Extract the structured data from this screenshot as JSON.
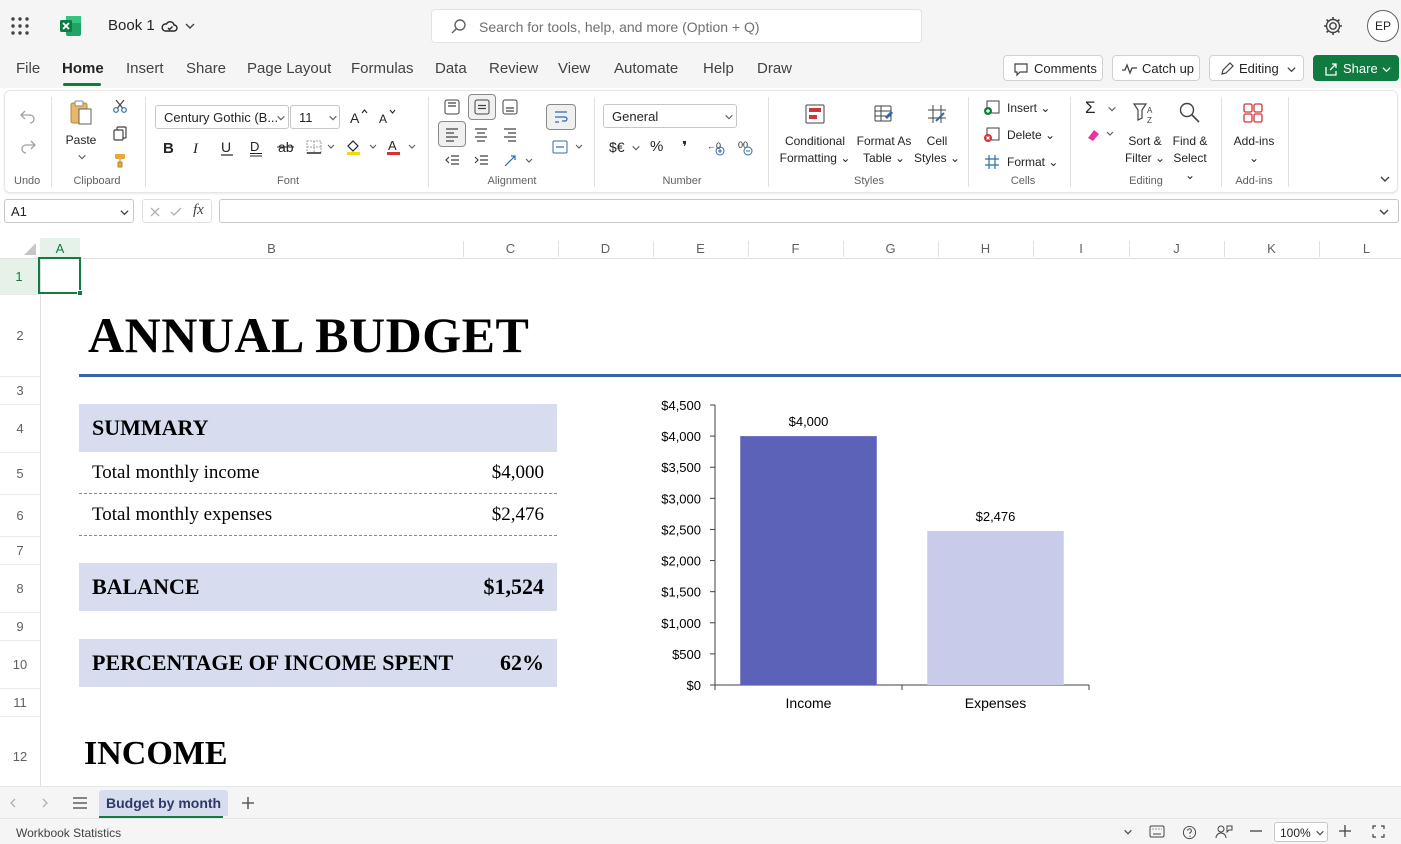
{
  "titlebar": {
    "book_name": "Book 1",
    "search_placeholder": "Search for tools, help, and more (Option + Q)",
    "avatar_initials": "EP"
  },
  "menu": {
    "items": [
      "File",
      "Home",
      "Insert",
      "Share",
      "Page Layout",
      "Formulas",
      "Data",
      "Review",
      "View",
      "Automate",
      "Help",
      "Draw"
    ],
    "active": "Home",
    "comments_label": "Comments",
    "catchup_label": "Catch up",
    "editing_label": "Editing",
    "share_label": "Share"
  },
  "ribbon": {
    "undo_group": "Undo",
    "clipboard": {
      "paste_label": "Paste",
      "group": "Clipboard"
    },
    "font": {
      "family": "Century Gothic (B...",
      "size": "11",
      "group": "Font"
    },
    "alignment": {
      "group": "Alignment"
    },
    "number": {
      "format": "General",
      "currency_glyph": "$€",
      "percent_glyph": "%",
      "comma_glyph": "❜",
      "group": "Number"
    },
    "styles": {
      "conditional_line1": "Conditional",
      "conditional_line2": "Formatting",
      "format_table_line1": "Format As",
      "format_table_line2": "Table",
      "cell_styles_line1": "Cell",
      "cell_styles_line2": "Styles",
      "group": "Styles"
    },
    "cells": {
      "insert": "Insert",
      "delete": "Delete",
      "format": "Format",
      "group": "Cells"
    },
    "editing": {
      "sort_line1": "Sort &",
      "sort_line2": "Filter",
      "find_line1": "Find &",
      "find_line2": "Select",
      "autosum_glyph": "Σ",
      "group": "Editing"
    },
    "addins": {
      "label": "Add-ins",
      "group": "Add-ins"
    }
  },
  "formula_bar": {
    "name_box": "A1",
    "fx_glyph": "fx",
    "formula": ""
  },
  "grid": {
    "columns": [
      "A",
      "B",
      "C",
      "D",
      "E",
      "F",
      "G",
      "H",
      "I",
      "J",
      "K",
      "L"
    ],
    "rows": [
      "1",
      "2",
      "3",
      "4",
      "5",
      "6",
      "7",
      "8",
      "9",
      "10",
      "11",
      "12"
    ],
    "selected_col": "A",
    "selected_row": "1"
  },
  "sheet": {
    "title": "ANNUAL BUDGET",
    "summary_header": "SUMMARY",
    "income_label": "Total monthly income",
    "income_value": "$4,000",
    "expenses_label": "Total monthly expenses",
    "expenses_value": "$2,476",
    "balance_label": "BALANCE",
    "balance_value": "$1,524",
    "pct_label": "PERCENTAGE OF INCOME SPENT",
    "pct_value": "62%",
    "income_section": "INCOME"
  },
  "chart_data": {
    "type": "bar",
    "categories": [
      "Income",
      "Expenses"
    ],
    "values": [
      4000,
      2476
    ],
    "data_labels": [
      "$4,000",
      "$2,476"
    ],
    "colors": [
      "#5b62b8",
      "#c9cbea"
    ],
    "y_ticks": [
      "$0",
      "$500",
      "$1,000",
      "$1,500",
      "$2,000",
      "$2,500",
      "$3,000",
      "$3,500",
      "$4,000",
      "$4,500"
    ],
    "ylim": [
      0,
      4500
    ],
    "title": "",
    "xlabel": "",
    "ylabel": "",
    "grid": false
  },
  "sheet_tabs": {
    "active": "Budget by month"
  },
  "status": {
    "text": "Workbook Statistics",
    "zoom": "100%"
  }
}
